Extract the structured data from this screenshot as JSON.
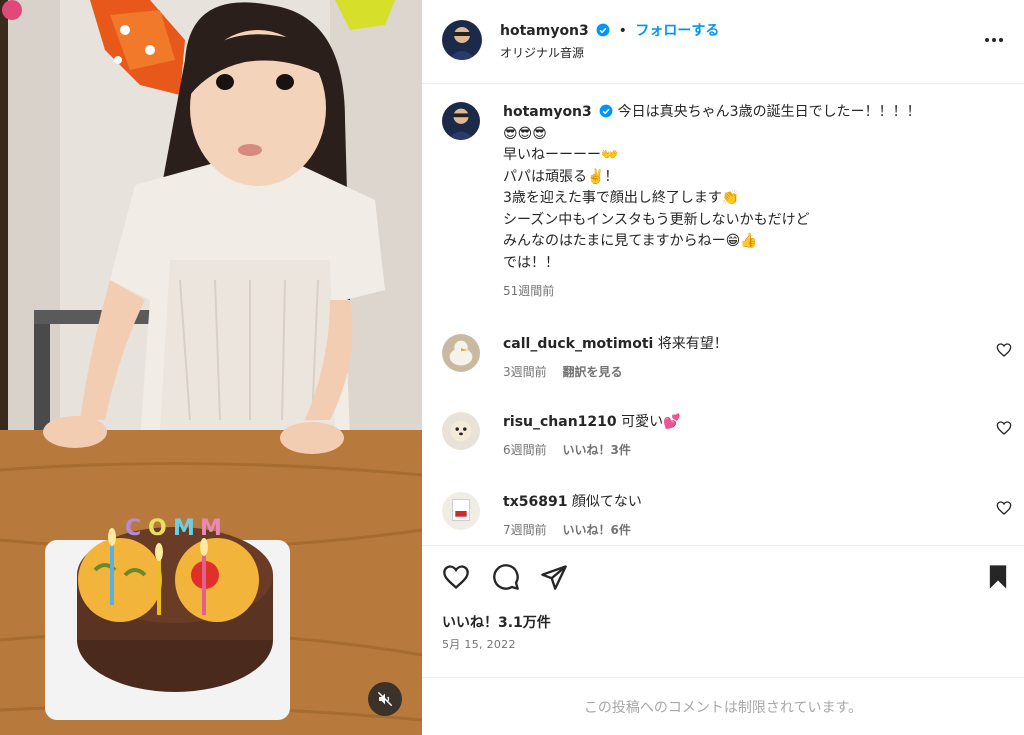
{
  "post": {
    "username": "hotamyon3",
    "follow_label": "フォローする",
    "separator": "•",
    "audio_label": "オリジナル音源",
    "caption_lines": [
      "今日は真央ちゃん3歳の誕生日でしたー！！！！",
      "😎😎😎",
      "早いねーーーー👐",
      "パパは頑張る✌️！",
      "3歳を迎えた事で顔出し終了します👏",
      "シーズン中もインスタもう更新しないかもだけど",
      "みんなのはたまに見てますからねー😁👍",
      "では！！"
    ],
    "caption_time": "51週間前",
    "likes": "いいね！3.1万件",
    "date": "5月 15, 2022",
    "comments_disabled": "この投稿へのコメントは制限されています。"
  },
  "comments": [
    {
      "username": "call_duck_motimoti",
      "text": "将来有望！",
      "time": "3週間前",
      "action": "翻訳を見る"
    },
    {
      "username": "risu_chan1210",
      "text": "可愛い💕",
      "time": "6週間前",
      "action": "いいね！3件"
    },
    {
      "username": "tx56891",
      "text": "顔似てない",
      "time": "7週間前",
      "action": "いいね！6件"
    }
  ],
  "icons": {
    "like": "heart-icon",
    "comment": "comment-bubble-icon",
    "share": "paper-plane-icon",
    "save": "bookmark-icon",
    "more": "more-horizontal-icon",
    "mute": "speaker-muted-icon",
    "verified": "verified-badge-icon"
  },
  "colors": {
    "accent": "#0095f6",
    "text": "#262626",
    "secondary": "#737373",
    "muted": "#a8a8a8",
    "border": "#efefef"
  }
}
